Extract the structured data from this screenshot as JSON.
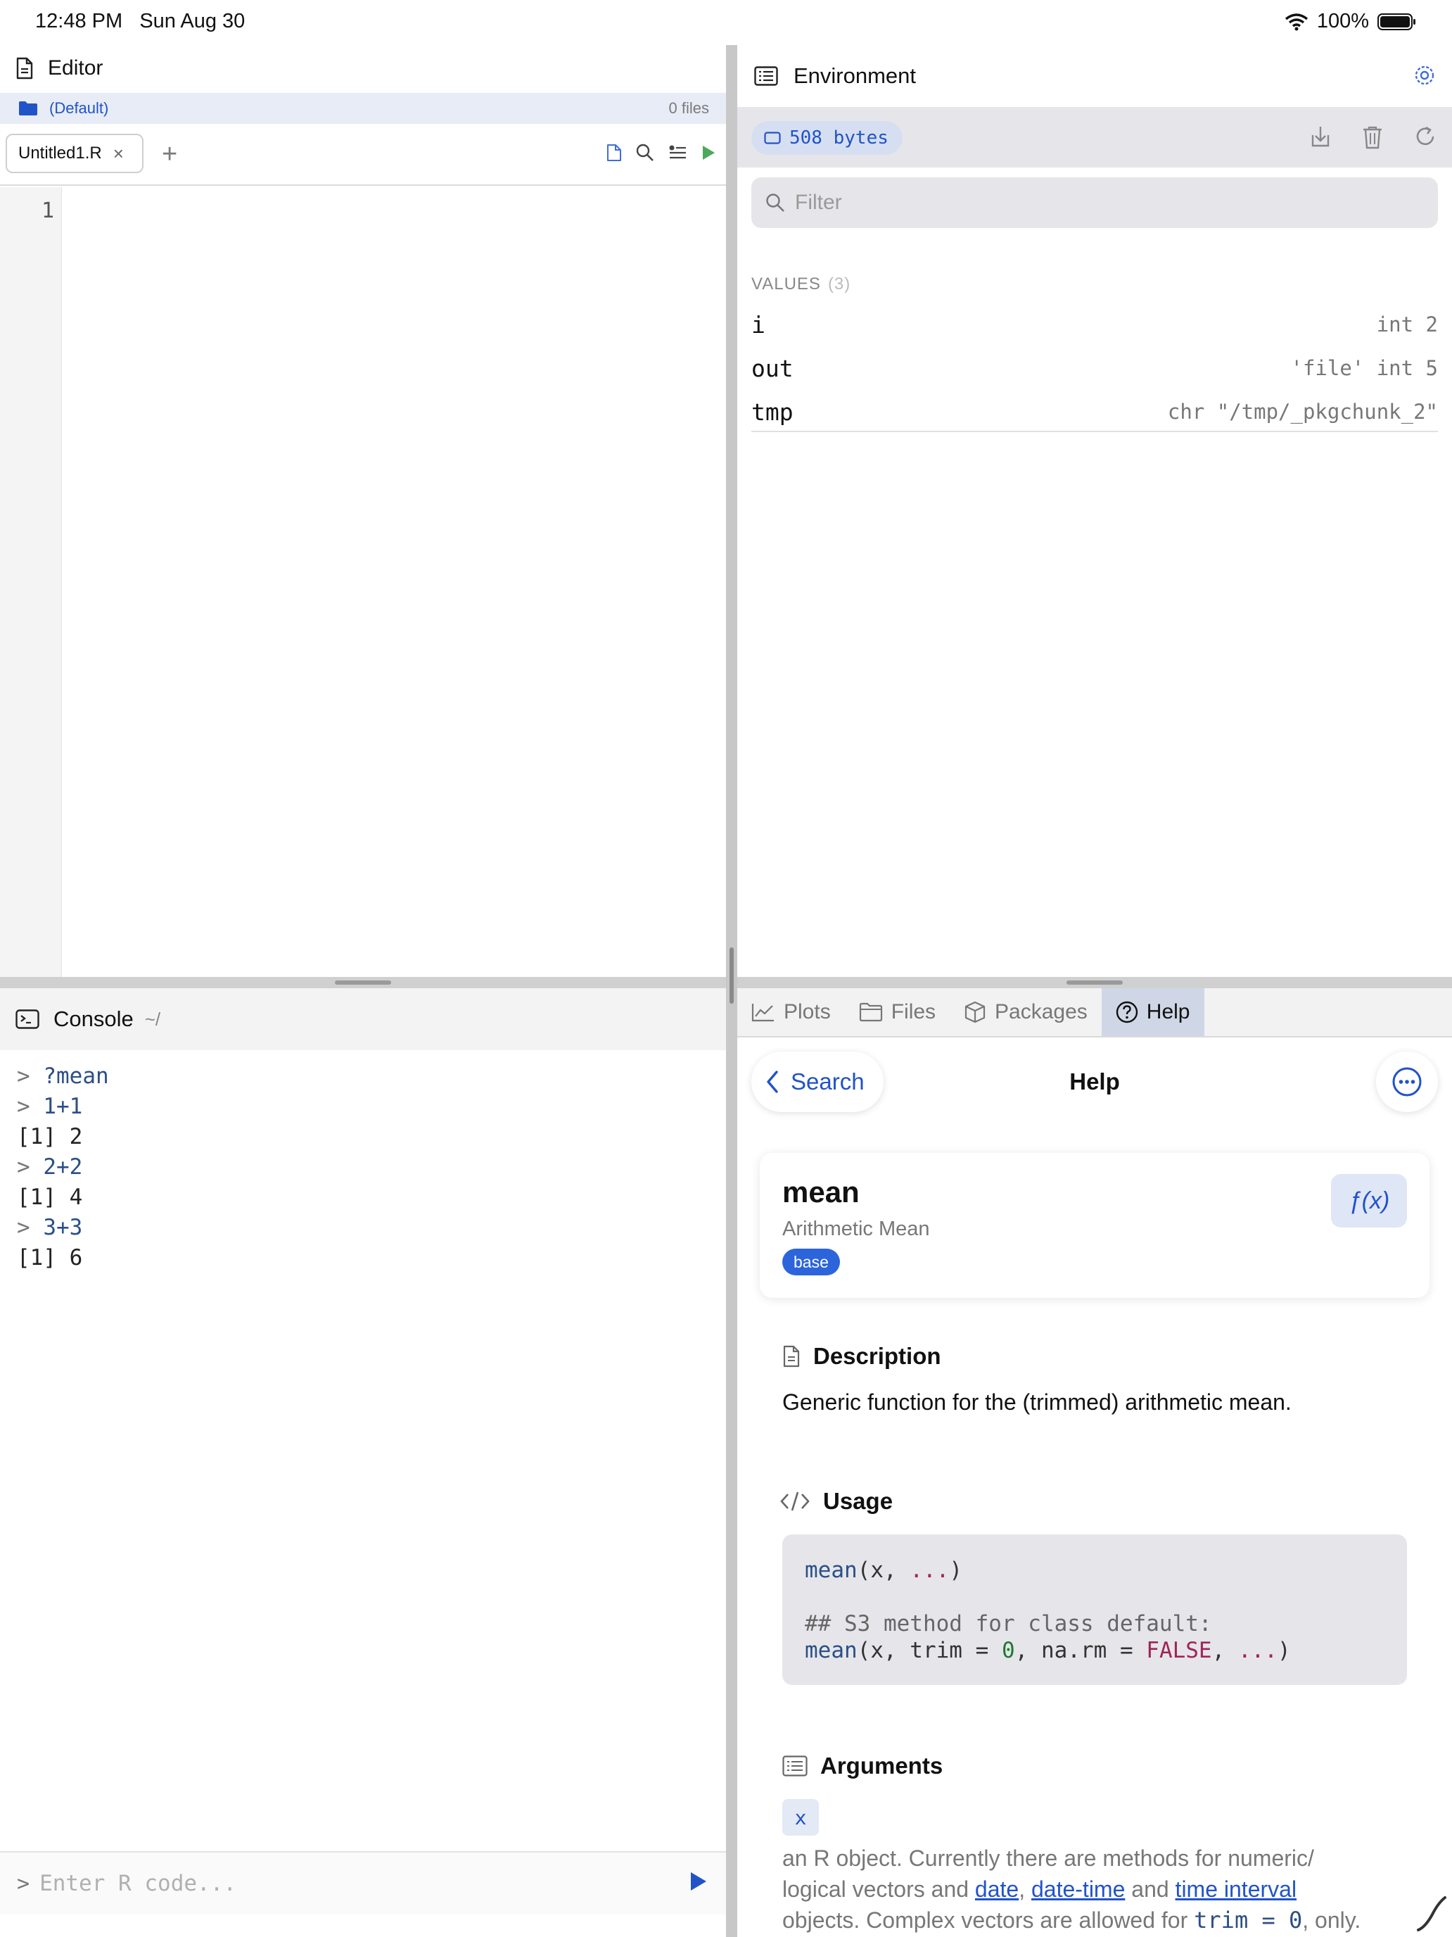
{
  "status_bar": {
    "time": "12:48 PM",
    "date": "Sun Aug 30",
    "battery": "100%"
  },
  "editor": {
    "title": "Editor",
    "project_name": "(Default)",
    "file_count": "0 files",
    "tab_label": "Untitled1.R",
    "tab_close": "×",
    "add_tab": "+",
    "line_number": "1"
  },
  "console": {
    "title": "Console",
    "path": "~/",
    "lines": [
      {
        "prompt": ">",
        "text": "?mean"
      },
      {
        "prompt": ">",
        "text": "1+1"
      },
      {
        "result": "[1] 2"
      },
      {
        "prompt": ">",
        "text": "2+2"
      },
      {
        "result": "[1] 4"
      },
      {
        "prompt": ">",
        "text": "3+3"
      },
      {
        "result": "[1] 6"
      }
    ],
    "input_prompt": ">",
    "input_placeholder": "Enter R code..."
  },
  "environment": {
    "title": "Environment",
    "memory": "508 bytes",
    "filter_placeholder": "Filter",
    "values_label": "VALUES",
    "values_count": "(3)",
    "values": [
      {
        "name": "i",
        "value": "int 2"
      },
      {
        "name": "out",
        "value": "'file' int 5"
      },
      {
        "name": "tmp",
        "value": "chr \"/tmp/_pkgchunk_2\""
      }
    ]
  },
  "panel_tabs": [
    {
      "label": "Plots",
      "icon": "chart-icon"
    },
    {
      "label": "Files",
      "icon": "folder-icon"
    },
    {
      "label": "Packages",
      "icon": "box-icon"
    },
    {
      "label": "Help",
      "icon": "question-icon",
      "active": true
    }
  ],
  "help": {
    "back_label": "Search",
    "title": "Help",
    "function_name": "mean",
    "function_title": "Arithmetic Mean",
    "package": "base",
    "badge": "ƒ(x)",
    "description_heading": "Description",
    "description": "Generic function for the (trimmed) arithmetic mean.",
    "usage_heading": "Usage",
    "arguments_heading": "Arguments",
    "argument_name": "x",
    "argument_description_1": "an R object. Currently there are methods for numeric/",
    "argument_description_2a": "logical vectors and ",
    "link_date": "date",
    "sep_comma": ", ",
    "link_datetime": "date-time",
    "sep_and": " and ",
    "link_interval": "time interval",
    "argument_description_3a": "objects. Complex vectors are allowed for ",
    "argument_code": "trim = 0",
    "argument_description_3b": ", only."
  },
  "colors": {
    "accent": "#2153c8",
    "active_tab": "#cfd7e6",
    "package_badge": "#2c64dc"
  }
}
